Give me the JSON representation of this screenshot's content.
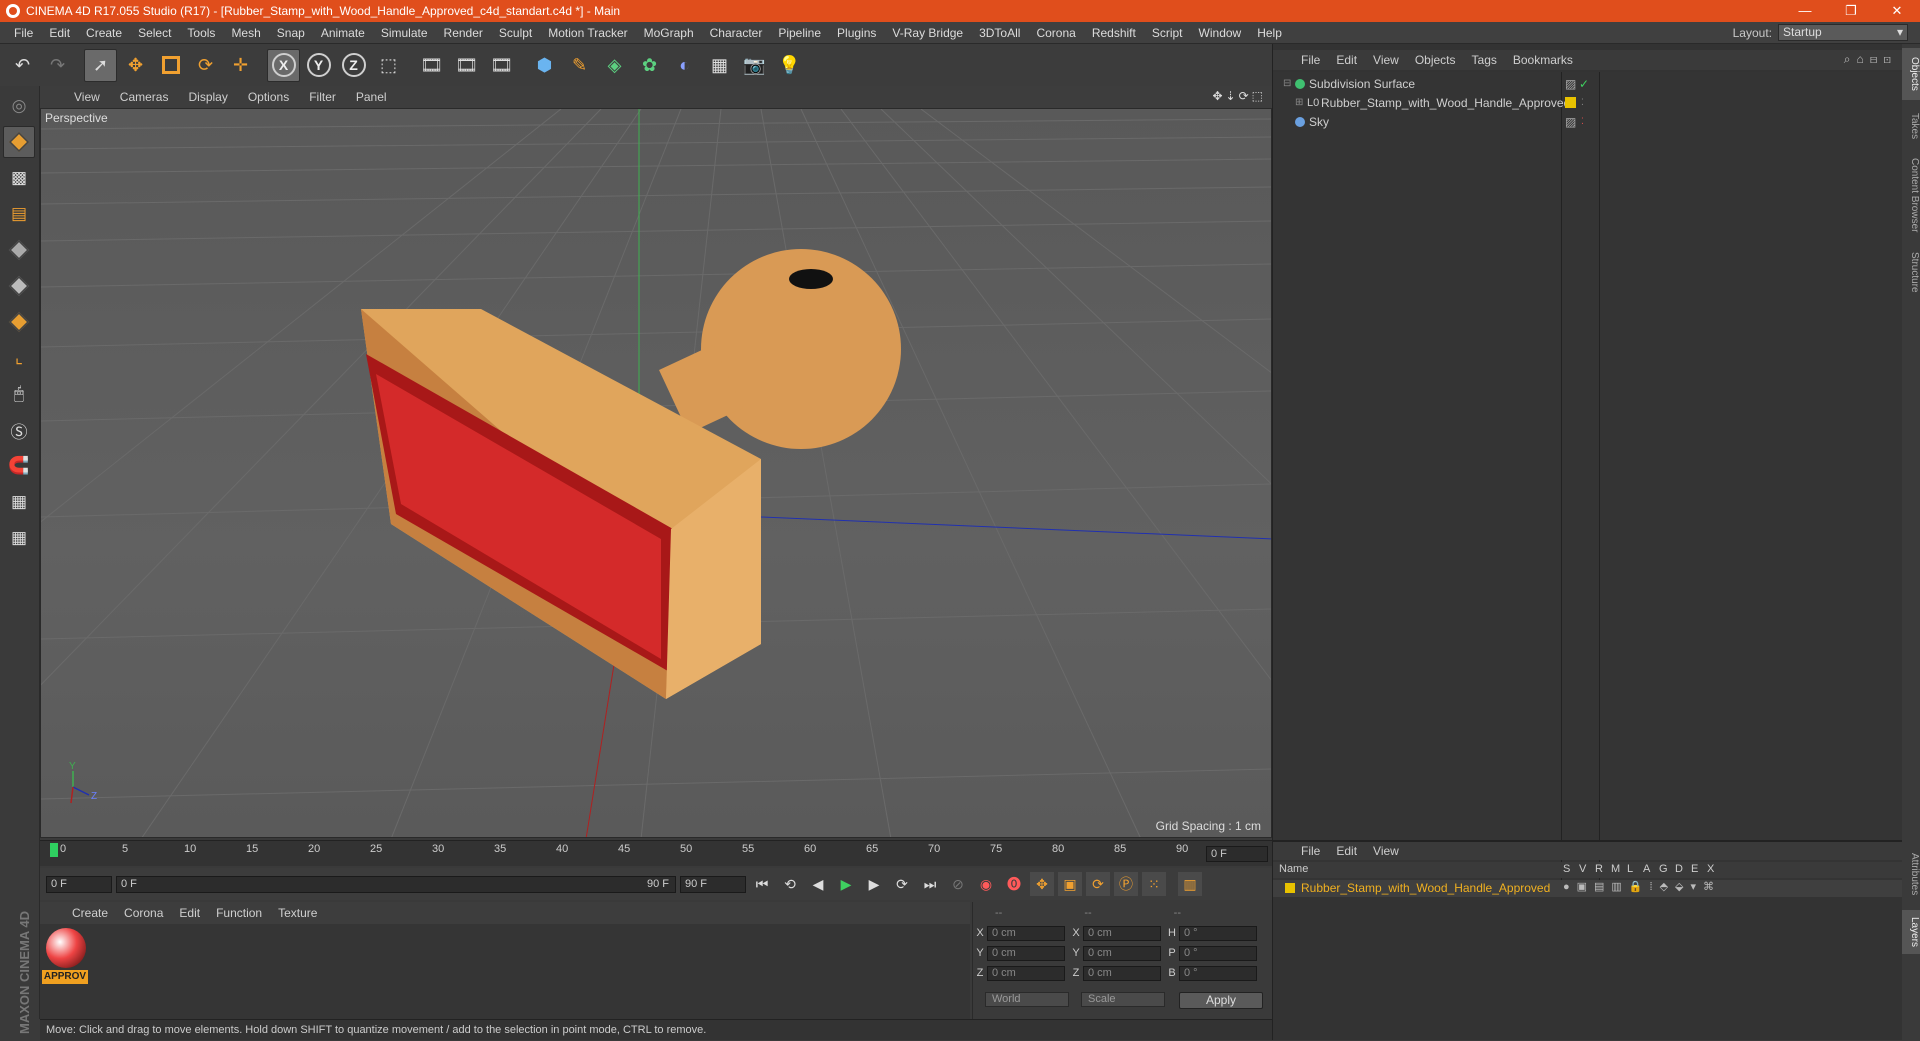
{
  "window": {
    "title": "CINEMA 4D R17.055 Studio (R17) - [Rubber_Stamp_with_Wood_Handle_Approved_c4d_standart.c4d *] - Main",
    "minimize": "—",
    "restore": "❐",
    "close": "✕"
  },
  "menu": [
    "File",
    "Edit",
    "Create",
    "Select",
    "Tools",
    "Mesh",
    "Snap",
    "Animate",
    "Simulate",
    "Render",
    "Sculpt",
    "Motion Tracker",
    "MoGraph",
    "Character",
    "Pipeline",
    "Plugins",
    "V-Ray Bridge",
    "3DToAll",
    "Corona",
    "Redshift",
    "Script",
    "Window",
    "Help"
  ],
  "layout": {
    "label": "Layout:",
    "value": "Startup"
  },
  "viewport": {
    "menu": [
      "View",
      "Cameras",
      "Display",
      "Options",
      "Filter",
      "Panel"
    ],
    "label": "Perspective",
    "grid_spacing": "Grid Spacing : 1 cm",
    "axis_y": "Y",
    "axis_z": "Z"
  },
  "timeline": {
    "ticks": [
      "0",
      "5",
      "10",
      "15",
      "20",
      "25",
      "30",
      "35",
      "40",
      "45",
      "50",
      "55",
      "60",
      "65",
      "70",
      "75",
      "80",
      "85",
      "90"
    ],
    "end_frame": "0 F"
  },
  "transport": {
    "start": "0 F",
    "range_start": "0 F",
    "range_end": "90 F",
    "end": "90 F"
  },
  "materials": {
    "menu": [
      "Create",
      "Corona",
      "Edit",
      "Function",
      "Texture"
    ],
    "item_label": "APPROV"
  },
  "coords": {
    "headers": [
      "--",
      "--",
      "--"
    ],
    "rows": [
      {
        "a": "X",
        "av": "0 cm",
        "b": "X",
        "bv": "0 cm",
        "c": "H",
        "cv": "0 °"
      },
      {
        "a": "Y",
        "av": "0 cm",
        "b": "Y",
        "bv": "0 cm",
        "c": "P",
        "cv": "0 °"
      },
      {
        "a": "Z",
        "av": "0 cm",
        "b": "Z",
        "bv": "0 cm",
        "c": "B",
        "cv": "0 °"
      }
    ],
    "space": "World",
    "mode": "Scale",
    "apply": "Apply"
  },
  "objects": {
    "menu": [
      "File",
      "Edit",
      "View",
      "Objects",
      "Tags",
      "Bookmarks"
    ],
    "items": [
      {
        "name": "Subdivision Surface"
      },
      {
        "name": "Rubber_Stamp_with_Wood_Handle_Approved"
      },
      {
        "name": "Sky"
      }
    ]
  },
  "layers": {
    "menu": [
      "File",
      "Edit",
      "View"
    ],
    "columns": {
      "name": "Name",
      "s": "S",
      "v": "V",
      "r": "R",
      "m": "M",
      "l": "L",
      "a": "A",
      "g": "G",
      "d": "D",
      "e": "E",
      "x": "X"
    },
    "row": "Rubber_Stamp_with_Wood_Handle_Approved"
  },
  "side_tabs": [
    "Objects",
    "Takes",
    "Content Browser",
    "Structure"
  ],
  "side_tabs_bottom": [
    "Attributes",
    "Layers"
  ],
  "status": "Move: Click and drag to move elements. Hold down SHIFT to quantize movement / add to the selection in point mode, CTRL to remove.",
  "brand": "MAXON CINEMA 4D",
  "colors": {
    "title_bar": "#e04e1c",
    "accent": "#f0a020",
    "layer_yellow": "#e8c200"
  }
}
